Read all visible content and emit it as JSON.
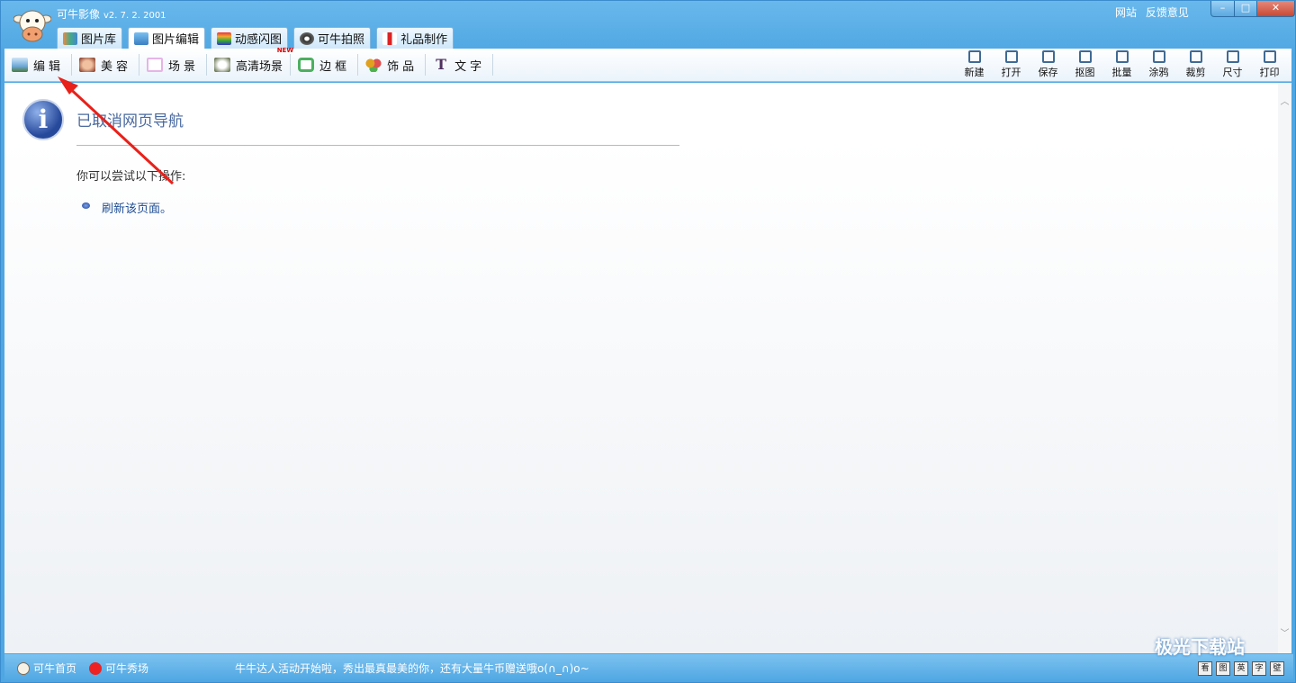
{
  "app": {
    "title": "可牛影像",
    "version": "v2. 7. 2. 2001"
  },
  "top_links": [
    "网站",
    "反馈意见"
  ],
  "window_buttons": {
    "minimize": "–",
    "maximize": "□",
    "close": "✕"
  },
  "tabs": [
    {
      "label": "图片库",
      "icon": "gallery-icon",
      "active": false
    },
    {
      "label": "图片编辑",
      "icon": "picture-edit-icon",
      "active": true
    },
    {
      "label": "动感闪图",
      "icon": "animation-icon",
      "active": false
    },
    {
      "label": "可牛拍照",
      "icon": "webcam-icon",
      "active": false
    },
    {
      "label": "礼品制作",
      "icon": "gift-icon",
      "active": false
    }
  ],
  "toolbar": {
    "left": [
      {
        "label": "编辑",
        "icon": "landscape-icon",
        "color": "#6fa8d8"
      },
      {
        "label": "美容",
        "icon": "face-icon",
        "color": "#c87060"
      },
      {
        "label": "场景",
        "icon": "scene-icon",
        "color": "#e6b4e6"
      },
      {
        "label": "高清场景",
        "icon": "hd-scene-icon",
        "color": "#8a9a60",
        "badge": "NEW"
      },
      {
        "label": "边框",
        "icon": "frame-icon",
        "color": "#4caf60"
      },
      {
        "label": "饰品",
        "icon": "ornament-icon",
        "color": "#e0a020"
      },
      {
        "label": "文字",
        "icon": "text-icon",
        "color": "#503060"
      }
    ],
    "right": [
      {
        "label": "新建",
        "icon": "new-file-icon"
      },
      {
        "label": "打开",
        "icon": "open-folder-icon"
      },
      {
        "label": "保存",
        "icon": "save-icon"
      },
      {
        "label": "抠图",
        "icon": "cutout-icon"
      },
      {
        "label": "批量",
        "icon": "batch-icon"
      },
      {
        "label": "涂鸦",
        "icon": "doodle-icon"
      },
      {
        "label": "裁剪",
        "icon": "crop-icon"
      },
      {
        "label": "尺寸",
        "icon": "resize-icon"
      },
      {
        "label": "打印",
        "icon": "print-icon"
      }
    ]
  },
  "content": {
    "title": "已取消网页导航",
    "hint": "你可以尝试以下操作:",
    "link": "刷新该页面。"
  },
  "statusbar": {
    "home": "可牛首页",
    "show": "可牛秀场",
    "message": "牛牛达人活动开始啦，秀出最真最美的你，还有大量牛币赠送哦o(∩_∩)o~",
    "icons": [
      "看",
      "图",
      "英",
      "字",
      "壁"
    ]
  },
  "watermark": "极光下载站",
  "colors": {
    "accent": "#4ea6e2",
    "link": "#1f4f95",
    "arrow": "#e8211a"
  }
}
